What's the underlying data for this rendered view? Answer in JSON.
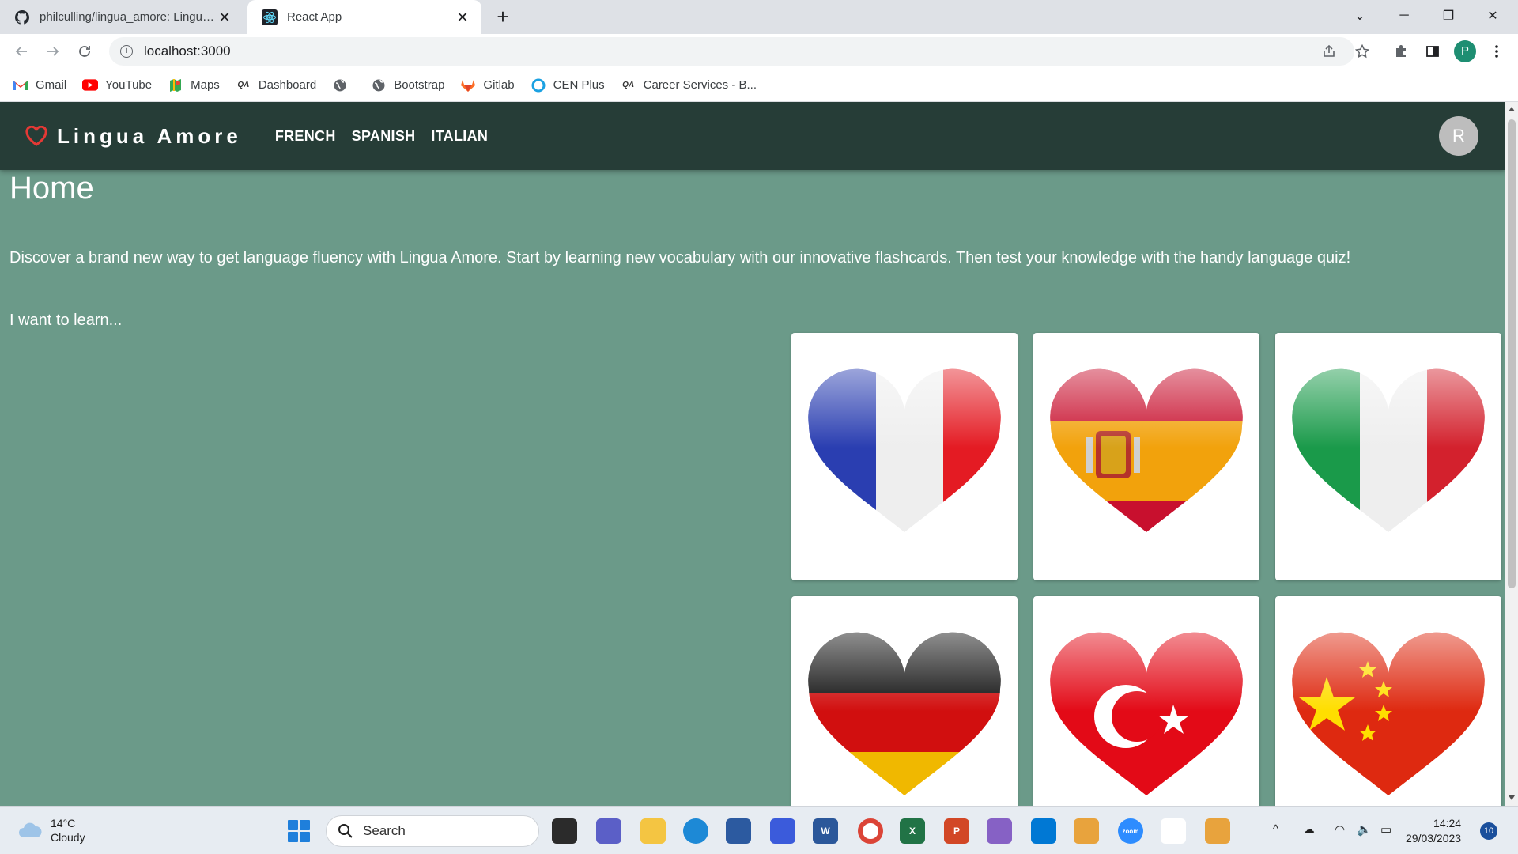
{
  "browser": {
    "tabs": [
      {
        "title": "philculling/lingua_amore: Lingua Amore",
        "icon": "github-icon",
        "active": false
      },
      {
        "title": "React App",
        "icon": "react-icon",
        "active": true
      }
    ],
    "url": "localhost:3000",
    "profile_initial": "P",
    "bookmarks": [
      {
        "label": "Gmail",
        "icon": "gmail-icon"
      },
      {
        "label": "YouTube",
        "icon": "youtube-icon"
      },
      {
        "label": "Maps",
        "icon": "maps-icon"
      },
      {
        "label": "Dashboard",
        "icon": "qa-logo-icon"
      },
      {
        "label": "",
        "icon": "globe-icon"
      },
      {
        "label": "Bootstrap",
        "icon": "globe-icon"
      },
      {
        "label": "Gitlab",
        "icon": "gitlab-icon"
      },
      {
        "label": "CEN Plus",
        "icon": "circle-icon"
      },
      {
        "label": "Career Services - B...",
        "icon": "qa-logo-icon"
      }
    ]
  },
  "app": {
    "brand": "Lingua Amore",
    "nav": [
      "FRENCH",
      "SPANISH",
      "ITALIAN"
    ],
    "avatar_initial": "R",
    "heading": "Home",
    "intro": "Discover a brand new way to get language fluency with Lingua Amore. Start by learning new vocabulary with our innovative flashcards. Then test your knowledge with the handy language quiz!",
    "prompt": "I want to learn...",
    "colors": {
      "navbar": "#263d37",
      "background": "#6b9a89",
      "heart_icon": "#e53935"
    },
    "language_cards": [
      {
        "flag": "france",
        "image": "france-heart-flag"
      },
      {
        "flag": "spain",
        "image": "spain-heart-flag"
      },
      {
        "flag": "italy",
        "image": "italy-heart-flag"
      },
      {
        "flag": "germany",
        "image": "germany-heart-flag"
      },
      {
        "flag": "turkey",
        "image": "turkey-heart-flag"
      },
      {
        "flag": "china",
        "image": "china-heart-flag"
      }
    ]
  },
  "taskbar": {
    "weather_temp": "14°C",
    "weather_desc": "Cloudy",
    "search_placeholder": "Search",
    "time": "14:24",
    "date": "29/03/2023",
    "notification_count": "10"
  }
}
